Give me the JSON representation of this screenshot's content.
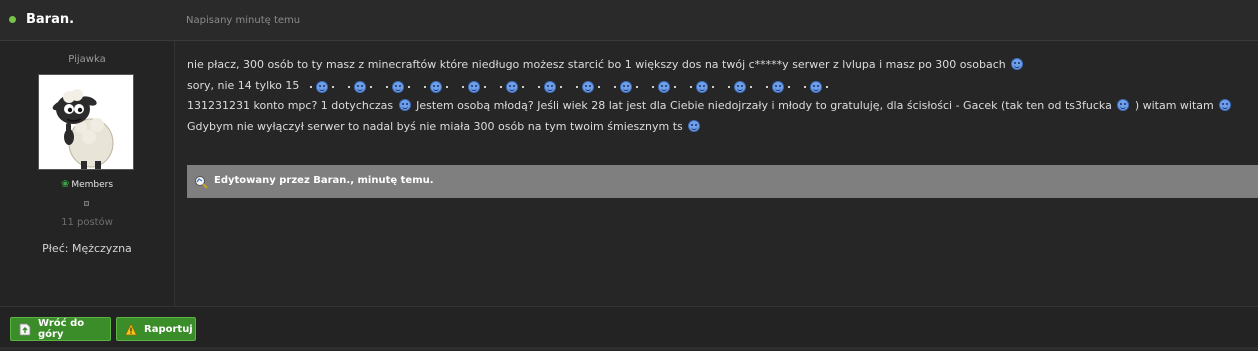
{
  "header": {
    "author": "Baran.",
    "posted": "Napisany minutę temu"
  },
  "sidebar": {
    "rank_title": "Pijawka",
    "group": "Members",
    "post_count": "11 postów",
    "gender": "Płeć: Mężczyzna"
  },
  "post": {
    "line1": "nie płacz, 300 osób to ty masz z minecraftów które niedługo możesz starcić bo 1 większy dos na twój c*****y serwer z lvlupa i masz po 300 osobach",
    "line2": "sory, nie 14 tylko 15",
    "line3_a": "131231231 konto mpc? 1 dotychczas",
    "line3_b": "Jestem osobą młodą? Jeśli wiek 28 lat jest dla Ciebie niedojrzały i młody to gratuluję, dla ścisłości - Gacek (tak ten od ts3fucka",
    "line3_c": ") witam witam",
    "line4": "Gdybym nie wyłączył serwer to nadal byś nie miała 300 osób na tym twoim śmiesznym ts",
    "edited": "Edytowany przez Baran., minutę temu."
  },
  "footer": {
    "back_to_top": "Wróć do góry",
    "report": "Raportuj"
  },
  "icons": {
    "smiley": "smiley-icon",
    "group": "group-icon",
    "edit": "edit-icon",
    "up": "up-icon",
    "warning": "warning-icon"
  },
  "colors": {
    "accent_green": "#3b8d2a",
    "online": "#79c24a",
    "edited_bar": "#7f7f7f"
  }
}
